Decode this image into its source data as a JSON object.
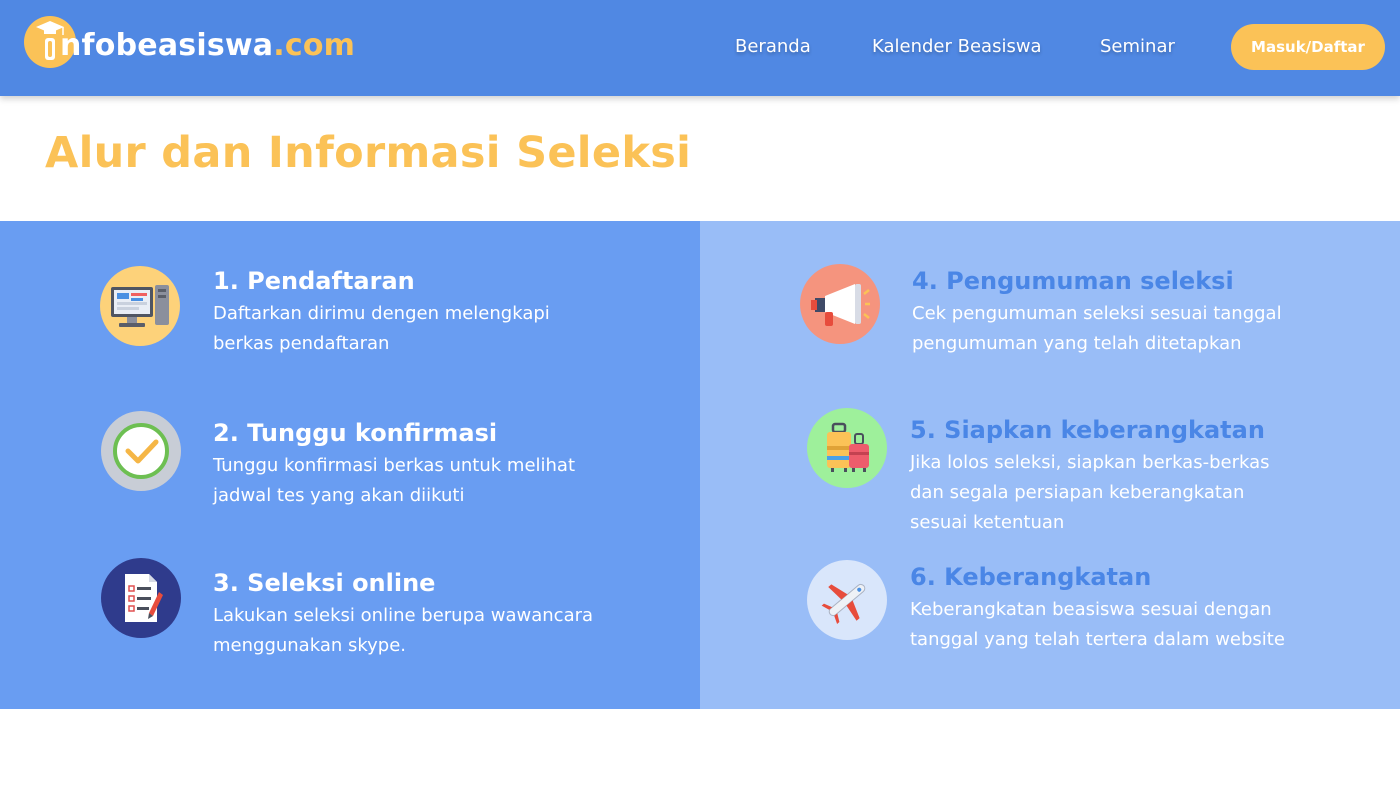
{
  "header": {
    "logo": {
      "text_main": "nfobeasiswa",
      "text_suffix": ".com"
    },
    "nav": [
      {
        "label": "Beranda"
      },
      {
        "label": "Kalender Beasiswa"
      },
      {
        "label": "Seminar"
      }
    ],
    "login_label": "Masuk/Daftar"
  },
  "page": {
    "title": "Alur dan Informasi Seleksi"
  },
  "steps": [
    {
      "title": "1.  Pendaftaran",
      "desc": "Daftarkan dirimu dengen melengkapi berkas pendaftaran",
      "icon": "computer-icon"
    },
    {
      "title": "2. Tunggu konfirmasi",
      "desc": "Tunggu konfirmasi berkas untuk melihat jadwal tes yang akan diikuti",
      "icon": "checkmark-icon"
    },
    {
      "title": "3. Seleksi online",
      "desc": "Lakukan seleksi online berupa wawancara menggunakan skype.",
      "icon": "checklist-document-icon"
    },
    {
      "title": "4. Pengumuman seleksi",
      "desc": "Cek pengumuman seleksi sesuai tanggal pengumuman yang telah ditetapkan",
      "icon": "megaphone-icon"
    },
    {
      "title": "5. Siapkan keberangkatan",
      "desc": "Jika lolos seleksi, siapkan berkas-berkas dan segala persiapan keberangkatan sesuai ketentuan",
      "icon": "luggage-icon"
    },
    {
      "title": "6. Keberangkatan",
      "desc": "Keberangkatan beasiswa sesuai dengan tanggal yang telah tertera dalam website",
      "icon": "airplane-icon"
    }
  ],
  "colors": {
    "nav_bg": "#5088e3",
    "accent_yellow": "#fbc257",
    "panel_left": "#699df2",
    "panel_right": "#99bdf7",
    "right_title": "#4a86e6"
  }
}
